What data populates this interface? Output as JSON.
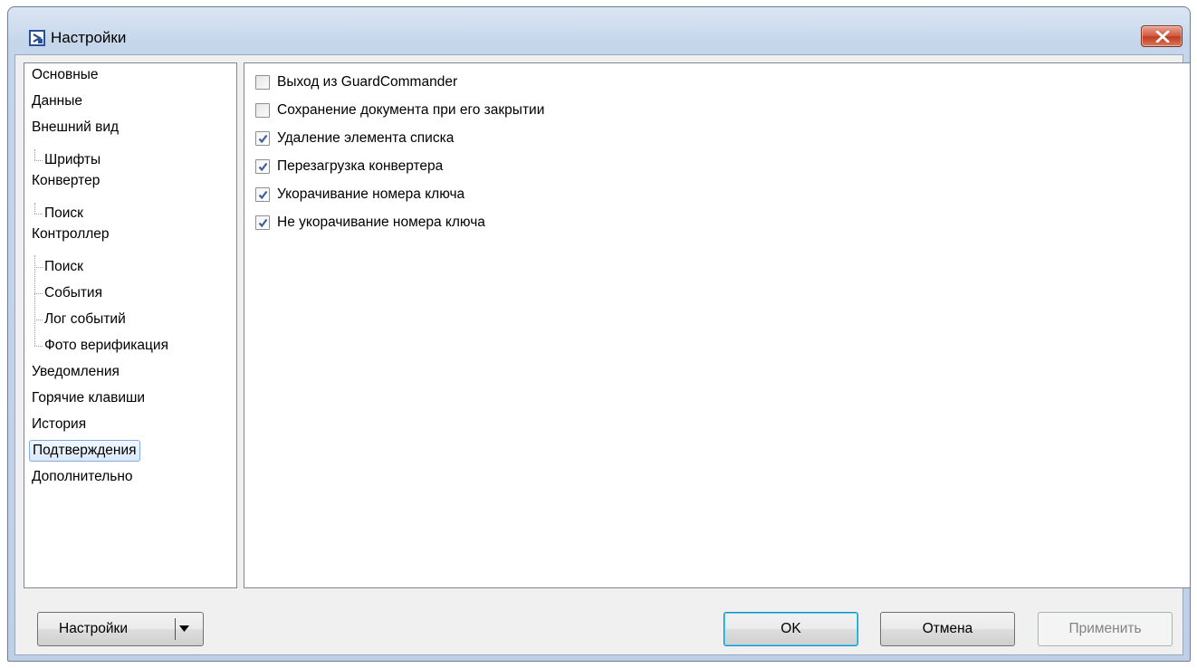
{
  "window": {
    "title": "Настройки",
    "icons": {
      "app": "guardcommander-app-icon",
      "close": "close-icon"
    }
  },
  "tree": {
    "items": [
      {
        "label": "Основные",
        "level": 0
      },
      {
        "label": "Данные",
        "level": 0
      },
      {
        "label": "Внешний вид",
        "level": 0
      },
      {
        "label": "Шрифты",
        "level": 1
      },
      {
        "label": "Конвертер",
        "level": 0
      },
      {
        "label": "Поиск",
        "level": 1
      },
      {
        "label": "Контроллер",
        "level": 0
      },
      {
        "label": "Поиск",
        "level": 1
      },
      {
        "label": "События",
        "level": 1
      },
      {
        "label": "Лог событий",
        "level": 1
      },
      {
        "label": "Фото верификация",
        "level": 1
      },
      {
        "label": "Уведомления",
        "level": 0
      },
      {
        "label": "Горячие клавиши",
        "level": 0
      },
      {
        "label": "История",
        "level": 0
      },
      {
        "label": "Подтверждения",
        "level": 0,
        "selected": true
      },
      {
        "label": "Дополнительно",
        "level": 0
      }
    ]
  },
  "confirmations": {
    "items": [
      {
        "label": "Выход из GuardCommander",
        "checked": false
      },
      {
        "label": "Сохранение документа при его закрытии",
        "checked": false
      },
      {
        "label": "Удаление элемента списка",
        "checked": true
      },
      {
        "label": "Перезагрузка конвертера",
        "checked": true
      },
      {
        "label": "Укорачивание номера ключа",
        "checked": true
      },
      {
        "label": "Не укорачивание номера ключа",
        "checked": true
      }
    ]
  },
  "footer": {
    "settings_label": "Настройки",
    "ok_label": "OK",
    "cancel_label": "Отмена",
    "apply_label": "Применить",
    "icons": {
      "dropdown": "dropdown-arrow-icon"
    }
  },
  "colors": {
    "checkmark": "#3d5f9e",
    "selection_border": "#84acdd",
    "default_button_border": "#3c7fb1"
  }
}
